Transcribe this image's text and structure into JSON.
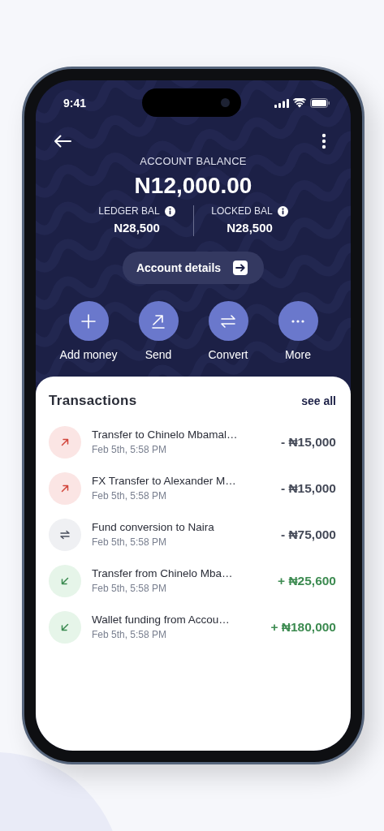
{
  "status_bar": {
    "time": "9:41"
  },
  "balance": {
    "label": "ACCOUNT BALANCE",
    "amount": "N12,000.00",
    "sub_balances": [
      {
        "label": "LEDGER BAL",
        "amount": "N28,500"
      },
      {
        "label": "LOCKED BAL",
        "amount": "N28,500"
      }
    ]
  },
  "account_details_button": "Account details",
  "actions": [
    {
      "label": "Add money",
      "kind": "add"
    },
    {
      "label": "Send",
      "kind": "send"
    },
    {
      "label": "Convert",
      "kind": "convert"
    },
    {
      "label": "More",
      "kind": "more"
    }
  ],
  "transactions": {
    "title": "Transactions",
    "see_all": "see all",
    "items": [
      {
        "title": "Transfer to Chinelo Mbamal…",
        "date": "Feb 5th, 5:58 PM",
        "amount": "- ₦15,000",
        "kind": "out"
      },
      {
        "title": "FX Transfer to Alexander M…",
        "date": "Feb 5th, 5:58 PM",
        "amount": "- ₦15,000",
        "kind": "out"
      },
      {
        "title": "Fund conversion to Naira",
        "date": "Feb 5th, 5:58 PM",
        "amount": "- ₦75,000",
        "kind": "convert"
      },
      {
        "title": "Transfer from Chinelo Mba…",
        "date": "Feb 5th, 5:58 PM",
        "amount": "+ ₦25,600",
        "kind": "in"
      },
      {
        "title": "Wallet funding from Accou…",
        "date": "Feb 5th, 5:58 PM",
        "amount": "+ ₦180,000",
        "kind": "in"
      }
    ]
  }
}
